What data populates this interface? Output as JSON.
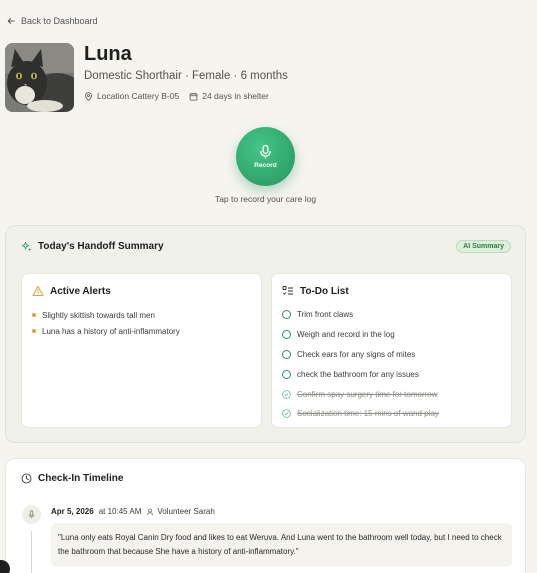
{
  "nav": {
    "back_label": "Back to Dashboard"
  },
  "pet": {
    "name": "Luna",
    "details": "Domestic Shorthair · Female · 6 months",
    "location": "Location Cattery B-05",
    "days": "24 days in shelter"
  },
  "record": {
    "label": "Record",
    "hint": "Tap to record your care log"
  },
  "handoff": {
    "title": "Today's Handoff Summary",
    "badge": "AI Summary",
    "alerts": {
      "title": "Active Alerts",
      "items": [
        "Slightly skittish towards tall men",
        "Luna has a history of anti-inflammatory"
      ]
    },
    "todo": {
      "title": "To-Do List",
      "items": [
        {
          "label": "Trim front claws",
          "done": false
        },
        {
          "label": "Weigh and record in the log",
          "done": false
        },
        {
          "label": "Check ears for any signs of mites",
          "done": false
        },
        {
          "label": "check the bathroom for any issues",
          "done": false
        },
        {
          "label": "Confirm spay surgery time for tomorrow",
          "done": true
        },
        {
          "label": "Socialization time: 15 mins of wand play",
          "done": true
        }
      ]
    }
  },
  "timeline": {
    "title": "Check-In Timeline",
    "entries": [
      {
        "date": "Apr 5, 2026",
        "time": "at 10:45 AM",
        "volunteer": "Volunteer Sarah",
        "text": "\"Luna only eats Royal Canin Dry food and likes to eat Weruva. And Luna went to the bathroom well today, but I need to check the bathroom that because She have a history of anti-inflammatory.\""
      }
    ]
  },
  "colors": {
    "accent": "#2fa46a",
    "alert": "#e3a23b",
    "background": "#f6f4ef"
  }
}
